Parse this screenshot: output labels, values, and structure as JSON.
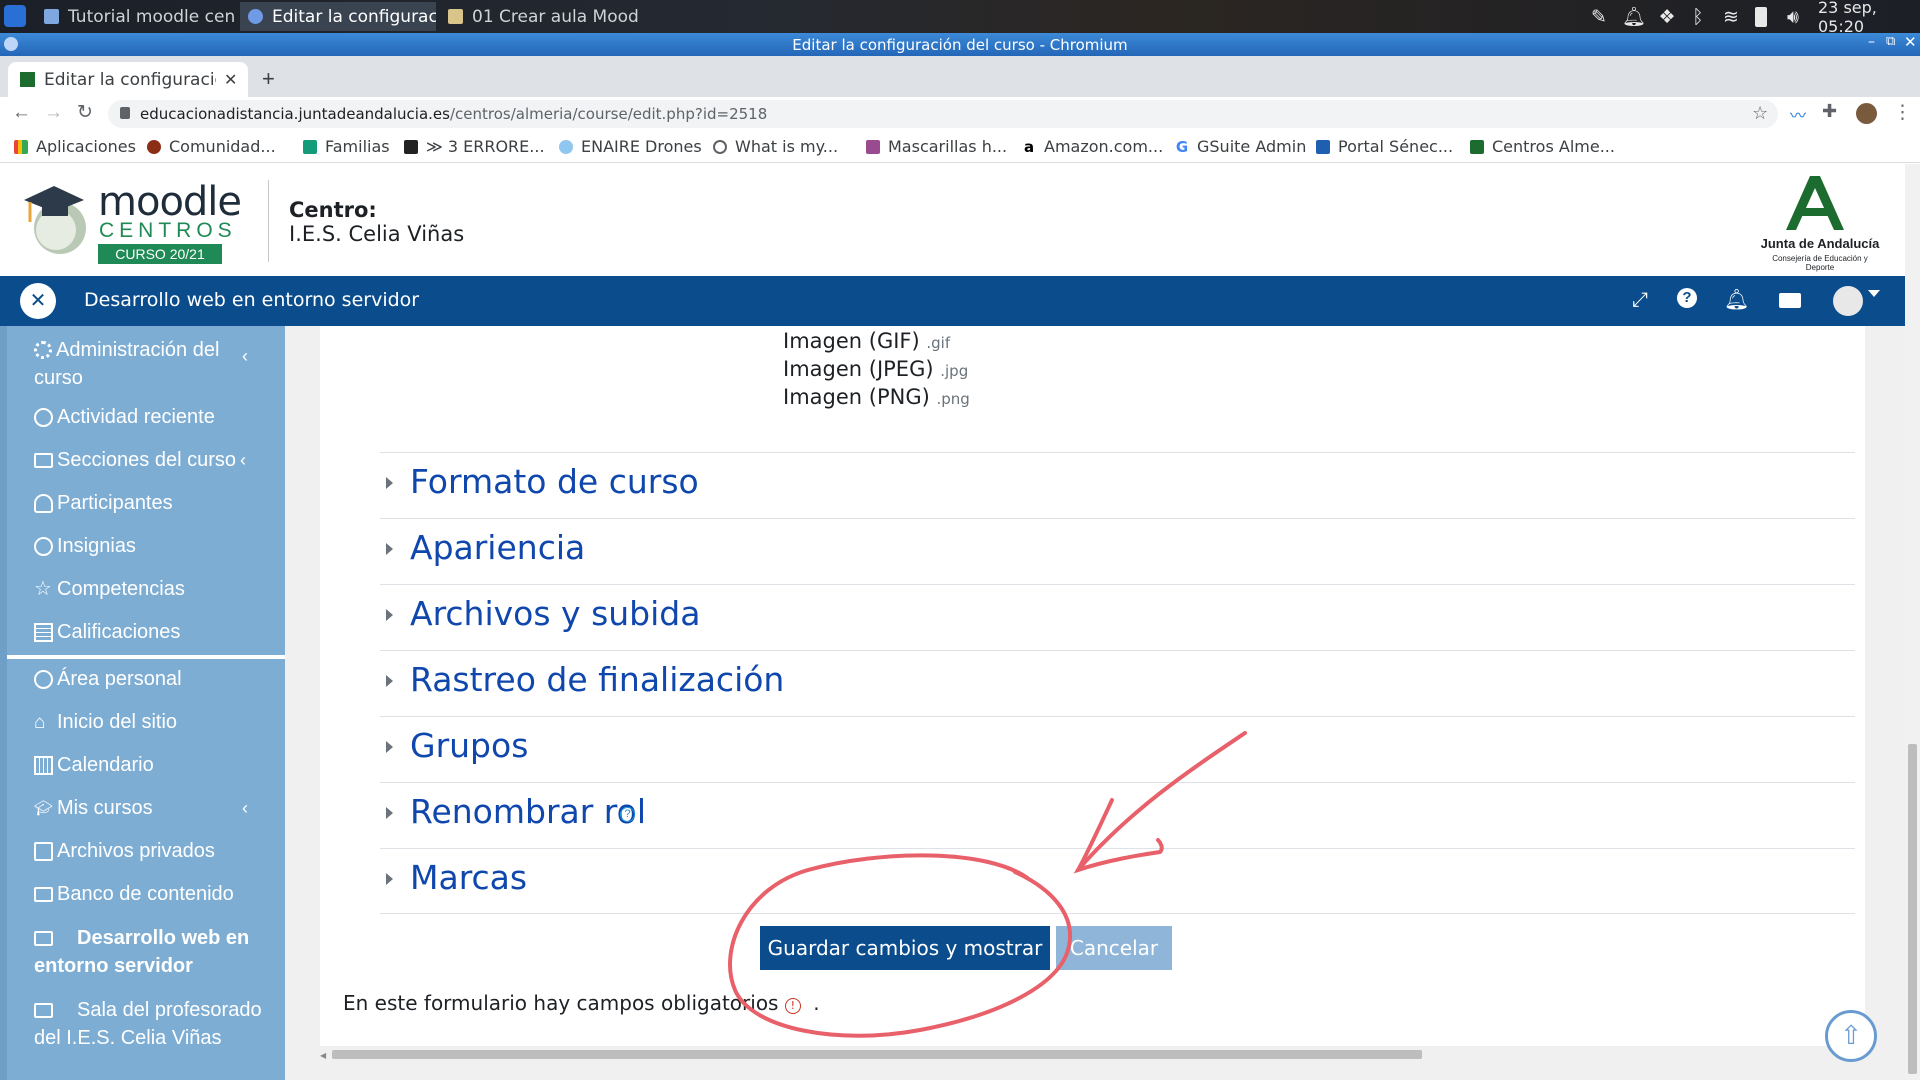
{
  "taskbar": {
    "tasks": [
      "Tutorial moodle cen...",
      "Editar la configuraci...",
      "01 Crear aula Moodl..."
    ],
    "datetime": "23 sep, 05:20"
  },
  "window": {
    "title": "Editar la configuración del curso - Chromium"
  },
  "browser": {
    "tab_title": "Editar la configuración",
    "url_domain": "educacionadistancia.juntadeandalucia.es",
    "url_path": "/centros/almeria/course/edit.php?id=2518",
    "bookmarks": [
      "Aplicaciones",
      "Comunidad...",
      "Familias",
      "≫ 3 ERRORE...",
      "ENAIRE Drones",
      "What is my...",
      "Mascarillas h...",
      "Amazon.com...",
      "GSuite Admin",
      "Portal Sénec...",
      "Centros Alme..."
    ]
  },
  "site": {
    "logo_moodle": "moodle",
    "logo_centros": "CENTROS",
    "logo_curso": "CURSO 20/21",
    "centro_label": "Centro:",
    "centro_name": "I.E.S. Celia Viñas",
    "junta_name": "Junta de Andalucía",
    "junta_sub": "Consejería de Educación y Deporte"
  },
  "navbar": {
    "course_title": "Desarrollo web en entorno servidor"
  },
  "sidebar": {
    "items": [
      {
        "label": "Administración del curso",
        "icon": "gears-icon"
      },
      {
        "label": "Actividad reciente",
        "icon": "clock-icon"
      },
      {
        "label": "Secciones del curso",
        "icon": "folder-icon"
      },
      {
        "label": "Participantes",
        "icon": "users-icon"
      },
      {
        "label": "Insignias",
        "icon": "badge-icon"
      },
      {
        "label": "Competencias",
        "icon": "star-icon"
      },
      {
        "label": "Calificaciones",
        "icon": "table-icon"
      },
      {
        "label": "Área personal",
        "icon": "dashboard-icon"
      },
      {
        "label": "Inicio del sitio",
        "icon": "home-icon"
      },
      {
        "label": "Calendario",
        "icon": "calendar-icon"
      },
      {
        "label": "Mis cursos",
        "icon": "graduation-cap-icon"
      },
      {
        "label": "Archivos privados",
        "icon": "file-icon"
      },
      {
        "label": "Banco de contenido",
        "icon": "folder-icon"
      },
      {
        "label": "Desarrollo web en entorno servidor",
        "icon": "folder-icon"
      },
      {
        "label": "Sala del profesorado del I.E.S. Celia Viñas",
        "icon": "folder-icon"
      }
    ]
  },
  "content": {
    "file_types": [
      {
        "name": "Imagen (GIF)",
        "ext": ".gif"
      },
      {
        "name": "Imagen (JPEG)",
        "ext": ".jpg"
      },
      {
        "name": "Imagen (PNG)",
        "ext": ".png"
      }
    ],
    "sections": [
      "Formato de curso",
      "Apariencia",
      "Archivos y subida",
      "Rastreo de finalización",
      "Grupos",
      "Renombrar rol",
      "Marcas"
    ],
    "save_button": "Guardar cambios y mostrar",
    "cancel_button": "Cancelar",
    "required_note": "En este formulario hay campos obligatorios",
    "required_tail": "."
  },
  "colors": {
    "navbar": "#0b4d8c",
    "sidebar": "#7eadd3",
    "link": "#0f47ad",
    "primary_button": "#0b4d8c",
    "annotation": "#e8606a"
  }
}
